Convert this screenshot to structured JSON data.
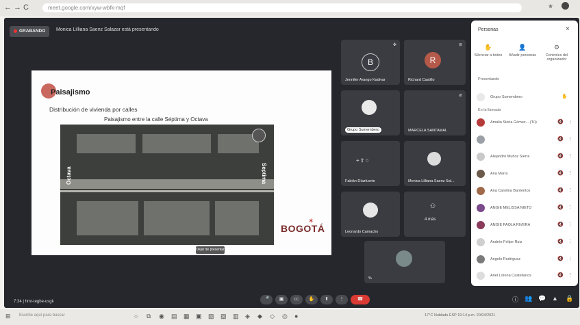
{
  "browser": {
    "url": "meet.google.com/xyw-wbfk-mqf",
    "nav_back": "←",
    "nav_forward": "→",
    "nav_reload": "C"
  },
  "meeting": {
    "recording_label": "GRABANDO",
    "presenting_label": "Monica Lilliana Saenz Salazar está presentando",
    "time": "7:34",
    "meeting_code": "hmr-tegbe-usgk"
  },
  "slide": {
    "title": "Paisajismo",
    "subtitle": "Distribución de vivienda por calles",
    "caption": "Paisajismo entre la calle Séptima y Octava",
    "label_left": "Octava",
    "label_right": "Septima",
    "logo_text": "BOGOTÁ",
    "caption_button": "Dejar de presentar"
  },
  "tiles": [
    {
      "name": "Jennifer Arango Kadivar",
      "initial": "B",
      "color": "#3a3b40",
      "avatar_color": "#3b3c44"
    },
    {
      "name": "Richard Castillo",
      "initial": "R",
      "color": "#3b3c41",
      "avatar_color": "#b55a4a"
    },
    {
      "name": "Grupo Sumembero",
      "initial": "",
      "color": "#3b3c41",
      "avatar_color": "#e9e9e9"
    },
    {
      "name": "MARCELA SANTAMAL",
      "initial": "",
      "color": "#3b3c41",
      "avatar_color": ""
    },
    {
      "name": "Fabián Díazfuerte",
      "initial": "",
      "color": "#3b3c41",
      "avatar_color": ""
    },
    {
      "name": "Monica Lilliana Saenz Sal...",
      "initial": "",
      "color": "#3b3c41",
      "avatar_color": "#dcdcdc"
    },
    {
      "name": "Leonardo Camacho",
      "initial": "",
      "color": "#3b3c41",
      "avatar_color": "#e6e6e6"
    },
    {
      "name": "4 más",
      "initial": "",
      "color": "#3b3c41",
      "avatar_color": ""
    },
    {
      "name": "%",
      "initial": "",
      "color": "#3b3c41",
      "avatar_color": "#7a8a8a"
    }
  ],
  "panel": {
    "title": "Personas",
    "close": "×",
    "buttons": [
      {
        "icon": "✋",
        "label": "Silenciar a todos"
      },
      {
        "icon": "👤",
        "label": "Añadir personas"
      },
      {
        "icon": "⚙",
        "label": "Controles del organizador"
      }
    ],
    "section_presenting": "Presentando",
    "presenting_row": "Grupo Sumembero",
    "section_participants": "En la llamada",
    "participants": [
      {
        "name": "Amalia Sieria Gómez... (Tú)",
        "color": "#b53a3a"
      },
      {
        "name": "",
        "color": "#9aa0a6"
      },
      {
        "name": "Alejandro Muñoz Sierra",
        "color": "#c9c9c9"
      },
      {
        "name": "Ana María",
        "color": "#6b5a4a"
      },
      {
        "name": "Ana Carolina Barrientos",
        "color": "#a06a4a"
      },
      {
        "name": "ANGIE MELISSA NIETO",
        "color": "#7a4a8a"
      },
      {
        "name": "ANGIE PAOLA RIVERA",
        "color": "#8a3a5a"
      },
      {
        "name": "Andrés Felipe Ruiz",
        "color": "#cfcfcf"
      },
      {
        "name": "Angelo Rodríguez",
        "color": "#7a7a7a"
      },
      {
        "name": "Ariel Lorena Castellanos",
        "color": "#dddddd"
      }
    ]
  },
  "controls": {
    "mic": "🎤",
    "cam": "▣",
    "cc": "CC",
    "hand": "✋",
    "present": "⬆",
    "more": "⋮",
    "end": "☎",
    "info": "ⓘ",
    "people": "👥",
    "chat": "💬",
    "activities": "▲",
    "lock": "🔒"
  },
  "taskbar": {
    "search_placeholder": "Escribe aquí para buscar",
    "tray_text": "17°C Nublado  ESP  10:14 p.m.  20/04/2021"
  }
}
